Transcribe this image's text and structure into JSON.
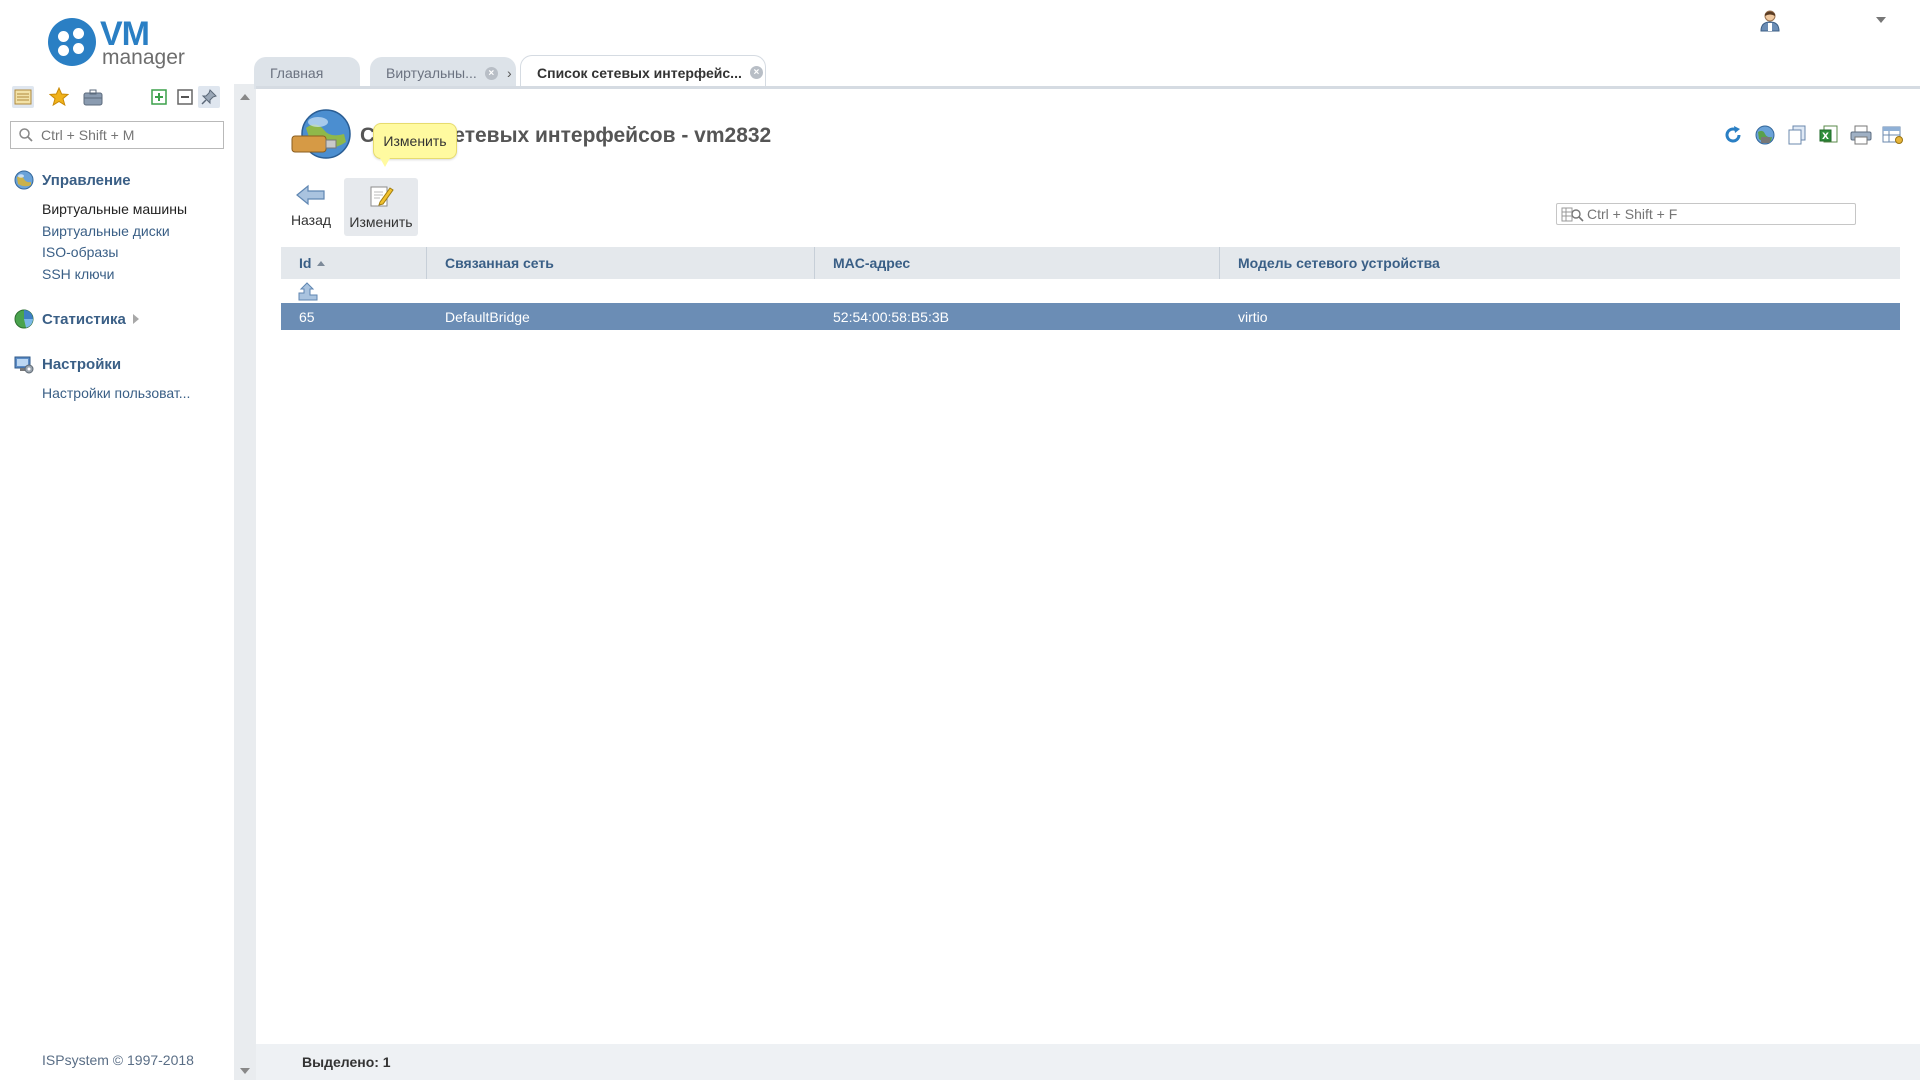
{
  "app": {
    "logo_vm": "VM",
    "logo_manager": "manager",
    "brand_color": "#2a7fc4"
  },
  "sidebar": {
    "search_placeholder": "Ctrl + Shift + M",
    "tools": [
      "tree-view-icon",
      "favorites-star-icon",
      "briefcase-icon",
      "expand-all-icon",
      "collapse-all-icon",
      "pin-icon"
    ],
    "groups": [
      {
        "title": "Управление",
        "icon": "management-globe-icon",
        "items": [
          {
            "label": "Виртуальные машины",
            "current": true
          },
          {
            "label": "Виртуальные диски",
            "current": false
          },
          {
            "label": "ISO-образы",
            "current": false
          },
          {
            "label": "SSH ключи",
            "current": false
          }
        ]
      },
      {
        "title": "Статистика",
        "icon": "statistics-pie-icon",
        "collapsed": true,
        "items": []
      },
      {
        "title": "Настройки",
        "icon": "settings-monitor-icon",
        "items": [
          {
            "label": "Настройки пользоват...",
            "current": false
          }
        ]
      }
    ],
    "copyright": "ISPsystem © 1997-2018"
  },
  "tabs": [
    {
      "label": "Главная",
      "closable": false,
      "active": false
    },
    {
      "label": "Виртуальны...",
      "closable": true,
      "active": false
    },
    {
      "label": "Список сетевых интерфейс...",
      "closable": true,
      "active": true
    }
  ],
  "tab_separator": "›",
  "tab_close_glyph": "×",
  "page": {
    "title": "Список сетевых интерфейсов - vm2832",
    "tooltip": "Изменить",
    "toolbar": {
      "back_label": "Назад",
      "edit_label": "Изменить"
    },
    "right_tools": [
      "refresh-icon",
      "network-globe-icon",
      "copy-icon",
      "export-excel-icon",
      "print-icon",
      "table-settings-icon"
    ],
    "filter_placeholder": "Ctrl + Shift + F"
  },
  "table": {
    "columns": [
      {
        "label": "Id",
        "sorted": "asc"
      },
      {
        "label": "Связанная сеть"
      },
      {
        "label": "MAC-адрес"
      },
      {
        "label": "Модель сетевого устройства"
      }
    ],
    "rows": [
      {
        "cells": [
          "65",
          "DefaultBridge",
          "52:54:00:58:B5:3B",
          "virtio"
        ],
        "selected": true
      }
    ],
    "selected_color": "#6b8db5"
  },
  "status": {
    "selected_text": "Выделено: 1"
  }
}
